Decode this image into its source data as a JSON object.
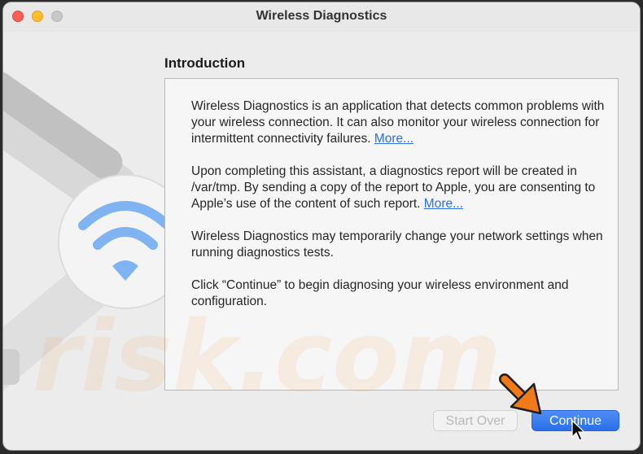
{
  "window": {
    "title": "Wireless Diagnostics"
  },
  "section": {
    "heading": "Introduction"
  },
  "content": {
    "p1_text": "Wireless Diagnostics is an application that detects common problems with your wireless connection. It can also monitor your wireless connection for intermittent connectivity failures. ",
    "p1_link": "More...",
    "p2_text": "Upon completing this assistant, a diagnostics report will be created in /var/tmp. By sending a copy of the report to Apple, you are consenting to Apple’s use of the content of such report. ",
    "p2_link": "More...",
    "p3_text": "Wireless Diagnostics may temporarily change your network settings when running diagnostics tests.",
    "p4_text": "Click “Continue” to begin diagnosing your wireless environment and configuration."
  },
  "buttons": {
    "start_over": "Start Over",
    "start_over_enabled": false,
    "continue": "Continue"
  },
  "watermark": {
    "text": "risk.com"
  },
  "icons": {
    "side": "wireless-diagnostics-app-icon",
    "annotation": "orange-arrow-icon",
    "cursor": "mouse-pointer-icon"
  },
  "colors": {
    "link": "#2f6fd9",
    "primary_button": "#2a6fe8",
    "close": "#ff5f57",
    "minimize": "#febc2e",
    "annotation_arrow": "#f07a1a"
  }
}
